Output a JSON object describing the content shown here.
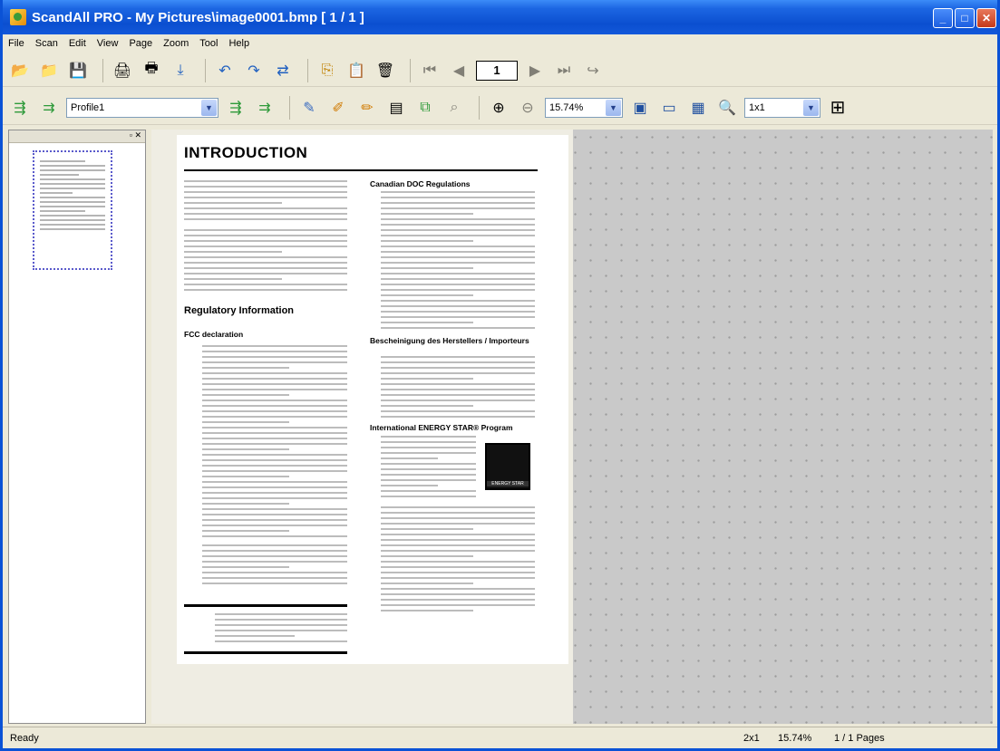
{
  "window": {
    "title": "ScandAll PRO - My Pictures\\image0001.bmp  [ 1 / 1 ]"
  },
  "menu": [
    "File",
    "Scan",
    "Edit",
    "View",
    "Page",
    "Zoom",
    "Tool",
    "Help"
  ],
  "toolbar": {
    "page_number": "1",
    "profile": "Profile1",
    "zoom": "15.74%",
    "layout": "1x1"
  },
  "document": {
    "heading": "INTRODUCTION",
    "sections": [
      "Regulatory Information",
      "FCC declaration",
      "Canadian DOC Regulations",
      "Bescheinigung des Herstellers / Importeurs",
      "International ENERGY STAR® Program"
    ],
    "energy_logo_text": "ENERGY STAR"
  },
  "status": {
    "left": "Ready",
    "layout": "2x1",
    "zoom": "15.74%",
    "pages": "1 / 1 Pages"
  }
}
